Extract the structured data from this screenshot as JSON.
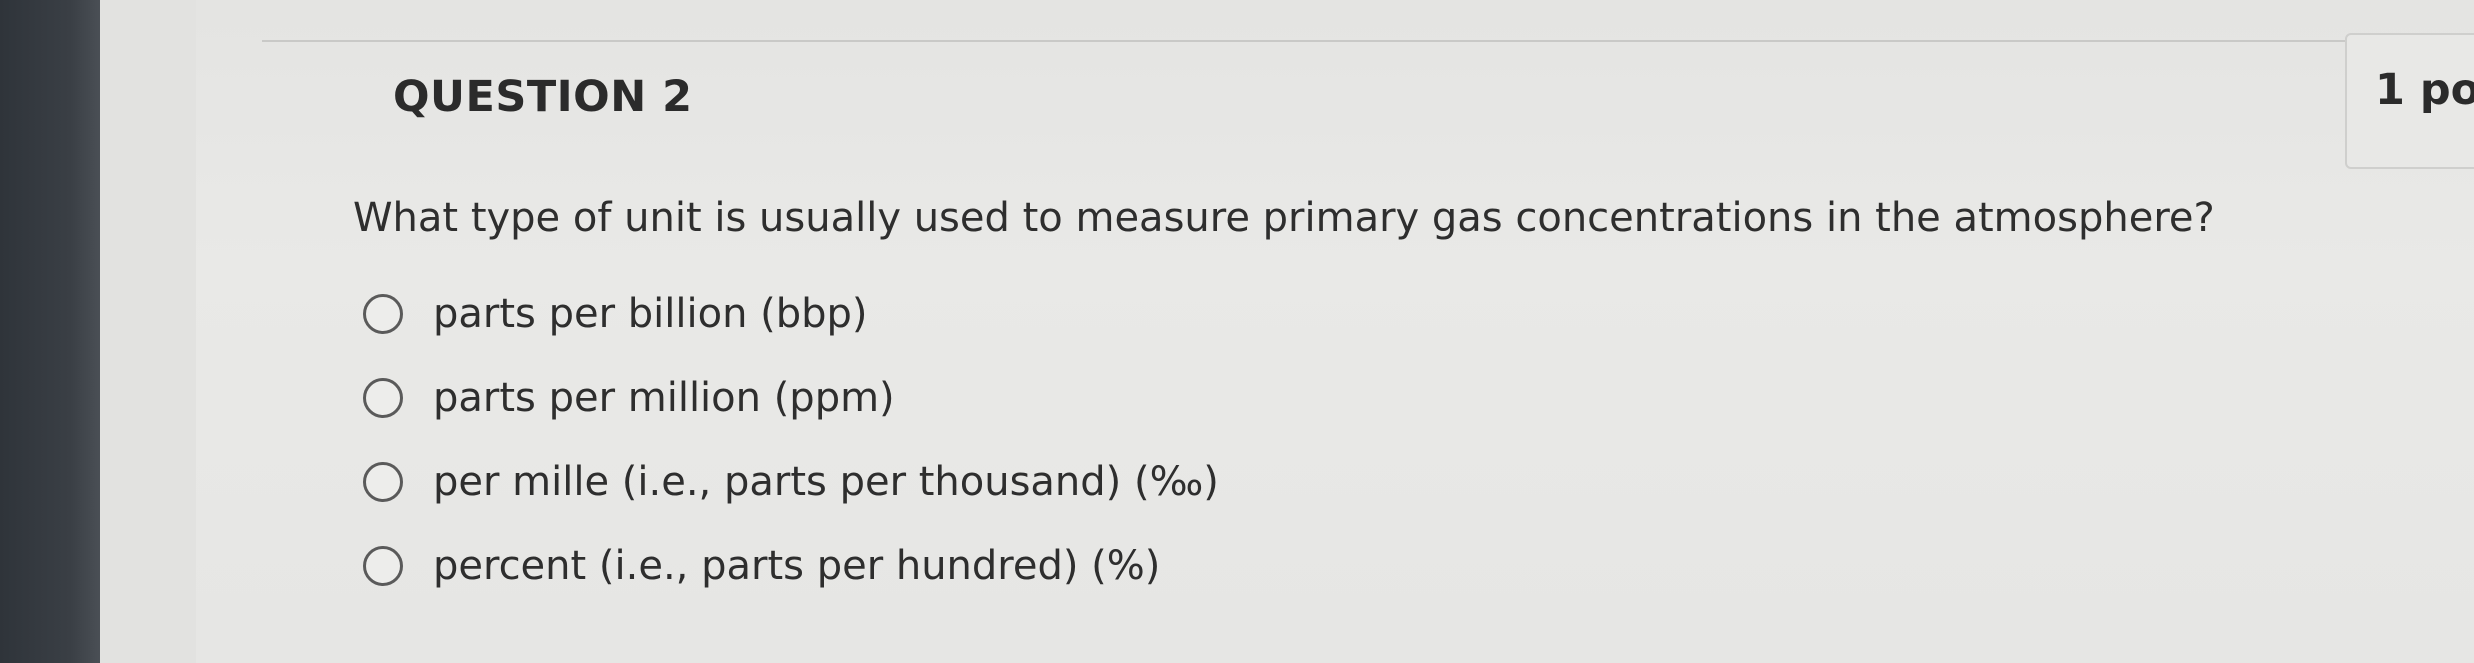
{
  "question": {
    "title": "QUESTION 2",
    "points": "1 po",
    "text": "What type of unit is usually used to measure primary gas concentrations in the atmosphere?"
  },
  "options": [
    {
      "label": "parts per billion (bbp)",
      "selected": false
    },
    {
      "label": "parts per million (ppm)",
      "selected": false
    },
    {
      "label": "per mille (i.e., parts per thousand) (‰)",
      "selected": false
    },
    {
      "label": "percent (i.e., parts per hundred) (%)",
      "selected": false
    }
  ]
}
